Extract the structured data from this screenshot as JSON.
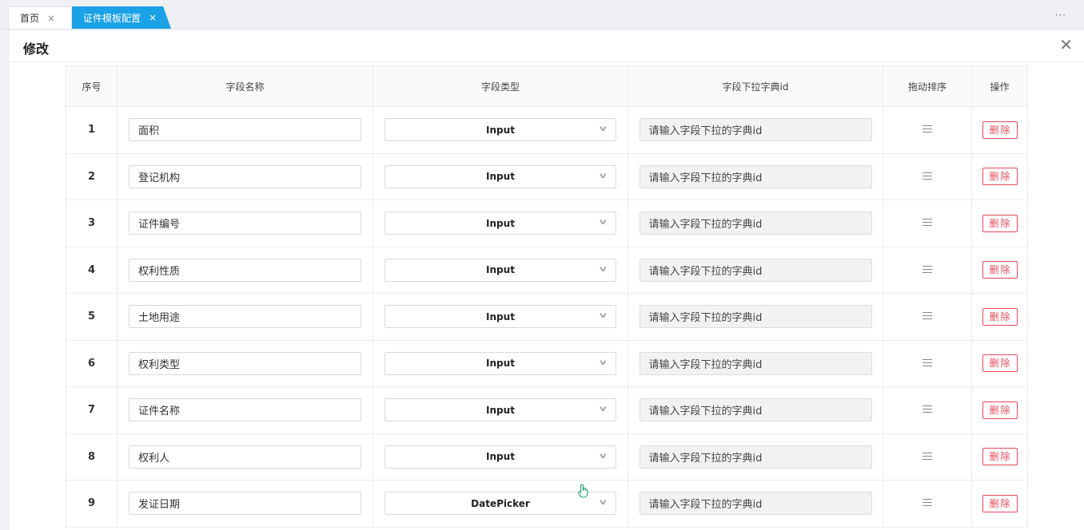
{
  "tabs": [
    {
      "label": "首页",
      "close": "×"
    },
    {
      "label": "证件模板配置",
      "close": "×"
    }
  ],
  "more_icon": "···",
  "panel": {
    "title": "修改",
    "close": "✕"
  },
  "table": {
    "headers": [
      "序号",
      "字段名称",
      "字段类型",
      "字段下拉字典id",
      "拖动排序",
      "操作"
    ],
    "dict_placeholder": "请输入字段下拉的字典id",
    "delete_label": "删除",
    "rows": [
      {
        "index": "1",
        "name": "面积",
        "type": "Input"
      },
      {
        "index": "2",
        "name": "登记机构",
        "type": "Input"
      },
      {
        "index": "3",
        "name": "证件编号",
        "type": "Input"
      },
      {
        "index": "4",
        "name": "权利性质",
        "type": "Input"
      },
      {
        "index": "5",
        "name": "土地用途",
        "type": "Input"
      },
      {
        "index": "6",
        "name": "权利类型",
        "type": "Input"
      },
      {
        "index": "7",
        "name": "证件名称",
        "type": "Input"
      },
      {
        "index": "8",
        "name": "权利人",
        "type": "Input"
      },
      {
        "index": "9",
        "name": "发证日期",
        "type": "DatePicker"
      }
    ]
  },
  "colors": {
    "accent": "#1aa1e6",
    "danger": "#e8495a"
  },
  "icons": {
    "drag": "drag-handle-icon",
    "select": "chevron-down-icon",
    "cursor": "hand-pointer-icon"
  }
}
